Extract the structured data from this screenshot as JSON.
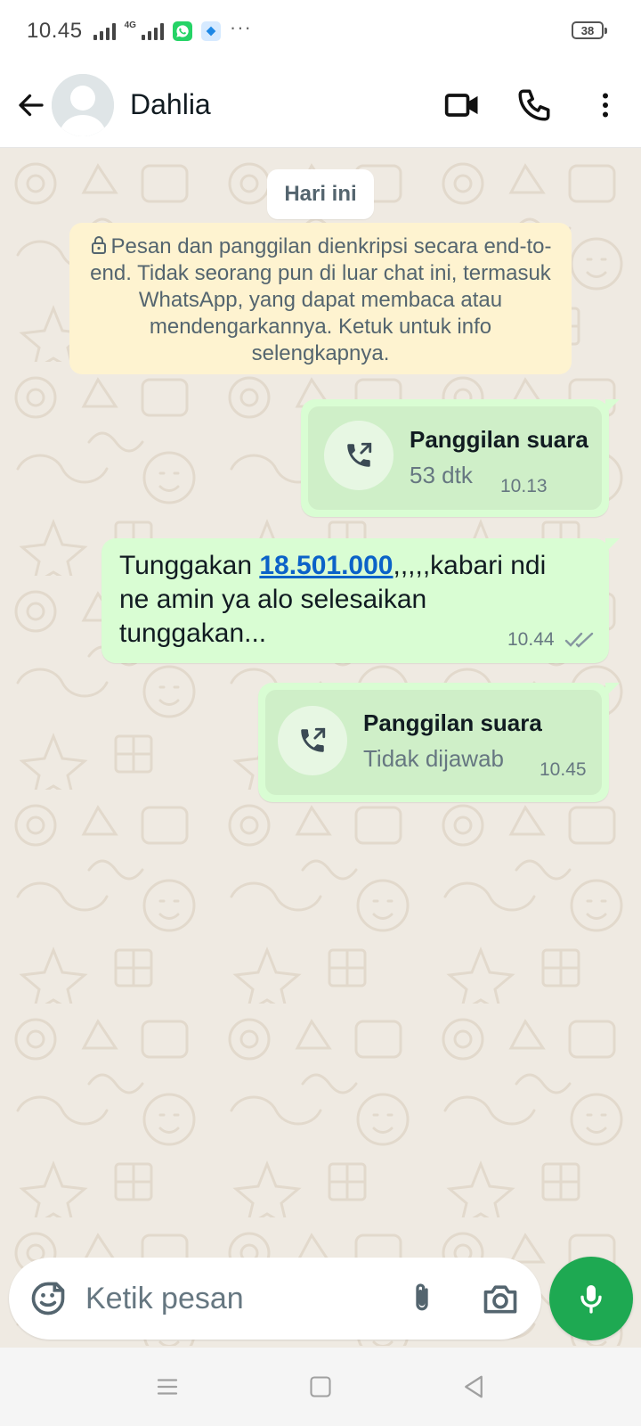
{
  "status_bar": {
    "time": "10.45",
    "network_badge": "4G",
    "battery_level": "38",
    "more": "···"
  },
  "header": {
    "contact_name": "Dahlia",
    "icons": [
      "back-arrow-icon",
      "avatar-placeholder",
      "video-call-icon",
      "voice-call-icon",
      "more-vert-icon"
    ]
  },
  "chat": {
    "date_chip": "Hari ini",
    "encryption_notice": "Pesan dan panggilan dienkripsi secara end-to-end. Tidak seorang pun di luar chat ini, termasuk WhatsApp, yang dapat membaca atau mendengarkannya. Ketuk untuk info selengkapnya.",
    "messages": [
      {
        "type": "call",
        "title": "Panggilan suara",
        "subtitle": "53 dtk",
        "time": "10.13",
        "icon": "outgoing-call-icon"
      },
      {
        "type": "text",
        "text_before": "Tunggakan ",
        "link_text": "18.501.000",
        "text_after": ",,,,,kabari ndi ne amin ya alo selesaikan tunggakan...",
        "time": "10.44",
        "status": "read-double-check"
      },
      {
        "type": "call",
        "title": "Panggilan suara",
        "subtitle": "Tidak dijawab",
        "time": "10.45",
        "icon": "outgoing-call-icon"
      }
    ]
  },
  "composer": {
    "placeholder": "Ketik pesan",
    "icons": [
      "sticker-icon",
      "attach-icon",
      "camera-icon",
      "mic-icon"
    ]
  },
  "colors": {
    "outgoing_bubble": "#d9fdd3",
    "call_inner": "#cfefc8",
    "notice_bg": "#fef3d0",
    "chat_bg": "#efeae2",
    "mic_button": "#1ea952",
    "link": "#0b62c8"
  },
  "nav_bar": {
    "icons": [
      "menu-icon",
      "home-icon",
      "back-icon"
    ]
  }
}
